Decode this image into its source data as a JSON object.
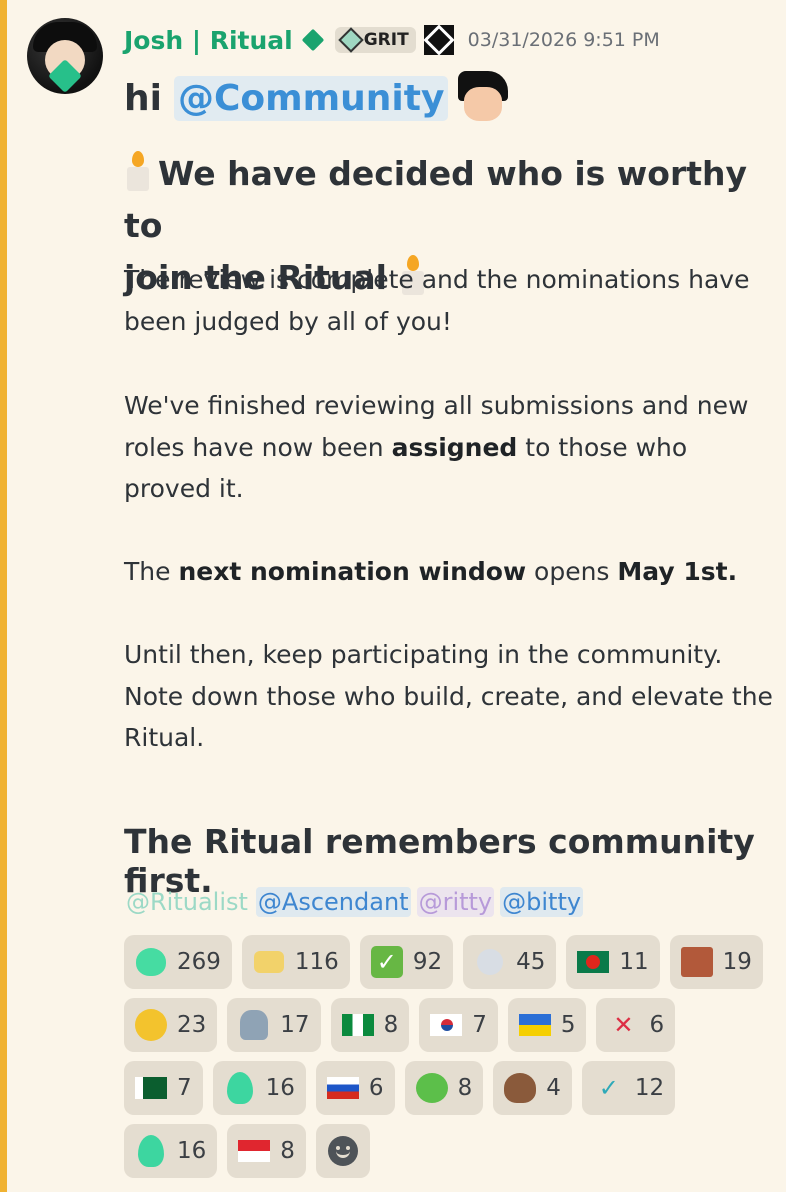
{
  "author": {
    "name": "Josh | Ritual",
    "role_tag": "GRIT",
    "timestamp": "03/31/2026 9:51 PM"
  },
  "message": {
    "greeting": "hi",
    "greeting_mention": "@Community",
    "heading_line1": "We have decided who is worthy to",
    "heading_line2": "join the Ritual",
    "p1": "The review is complete and the nominations have been judged by all of you!",
    "p2_before": "We've finished reviewing all submissions and new roles have now been ",
    "p2_bold": "assigned",
    "p2_after": " to those who proved it.",
    "p3_before": "The ",
    "p3_bold": "next nomination window",
    "p3_mid": " opens ",
    "p3_bold2": "May 1st.",
    "p4": "Until then, keep participating in the community. Note down those who build, create, and elevate the Ritual.",
    "closing": "The Ritual remembers community first.",
    "role_mentions": [
      "@Ritualist",
      "@Ascendant",
      "@ritty",
      "@bitty"
    ]
  },
  "reactions": [
    {
      "emoji": "green-heart",
      "count": "269"
    },
    {
      "emoji": "heart-hands",
      "count": "116"
    },
    {
      "emoji": "check-mark",
      "count": "92"
    },
    {
      "emoji": "skull",
      "count": "45"
    },
    {
      "emoji": "flag-bangladesh",
      "count": "11"
    },
    {
      "emoji": "custom-face",
      "count": "19"
    },
    {
      "emoji": "heart-eyes",
      "count": "23"
    },
    {
      "emoji": "ghost-figure",
      "count": "17"
    },
    {
      "emoji": "flag-nigeria",
      "count": "8"
    },
    {
      "emoji": "flag-south-korea",
      "count": "7"
    },
    {
      "emoji": "flag-ukraine",
      "count": "5"
    },
    {
      "emoji": "cross-mark",
      "count": "6"
    },
    {
      "emoji": "flag-pakistan",
      "count": "7"
    },
    {
      "emoji": "green-flame",
      "count": "16"
    },
    {
      "emoji": "flag-russia",
      "count": "6"
    },
    {
      "emoji": "pepe-frog",
      "count": "8"
    },
    {
      "emoji": "poop",
      "count": "4"
    },
    {
      "emoji": "check-tick",
      "count": "12"
    },
    {
      "emoji": "green-fire",
      "count": "16"
    },
    {
      "emoji": "flag-indonesia",
      "count": "8"
    }
  ],
  "colors": {
    "username": "#1aa36e",
    "mention": "#3b8fd6",
    "highlight_bar": "#f0b232",
    "background": "#fbf5e9"
  }
}
